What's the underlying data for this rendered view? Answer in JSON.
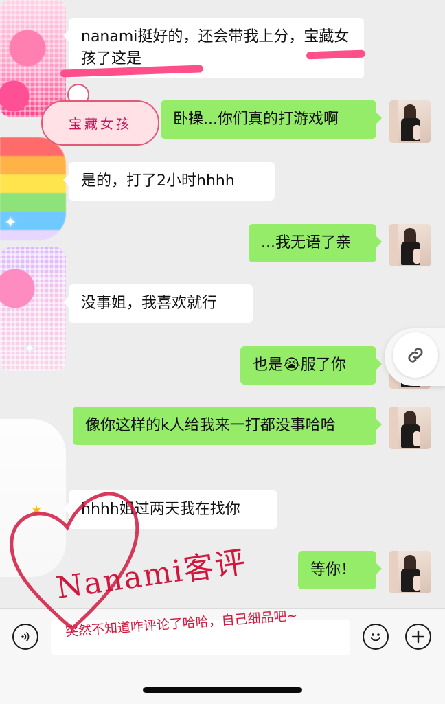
{
  "messages": [
    {
      "id": 1,
      "side": "in",
      "text": "nanami挺好的，还会带我上分，宝藏女孩了这是"
    },
    {
      "id": 2,
      "side": "out",
      "text": "卧操...你们真的打游戏啊"
    },
    {
      "id": 3,
      "side": "in",
      "text": "是的，打了2小时hhhh"
    },
    {
      "id": 4,
      "side": "out",
      "text": "...我无语了亲"
    },
    {
      "id": 5,
      "side": "in",
      "text": "没事姐，我喜欢就行"
    },
    {
      "id": 6,
      "side": "out",
      "text_before": "也是",
      "emoji": "😭",
      "text_after": "服了你"
    },
    {
      "id": 7,
      "side": "out",
      "text": "像你这样的k人给我来一打都没事哈哈"
    },
    {
      "id": 8,
      "side": "in",
      "text": "hhhh姐过两天我在找你"
    },
    {
      "id": 9,
      "side": "out",
      "text": "等你！"
    }
  ],
  "sticker": {
    "cloud_text": "宝藏女孩"
  },
  "watermark": {
    "title": "Nanami客评",
    "subtitle": "突然不知道咋评论了哈哈，自己细品吧~"
  },
  "input_bar": {
    "placeholder": "",
    "voice_icon": "voice-icon",
    "emoji_icon": "emoji-icon",
    "plus_icon": "plus-icon"
  },
  "colors": {
    "outgoing": "#95ec69",
    "incoming": "#ffffff",
    "background": "#ededed",
    "accent": "#d0183e"
  }
}
